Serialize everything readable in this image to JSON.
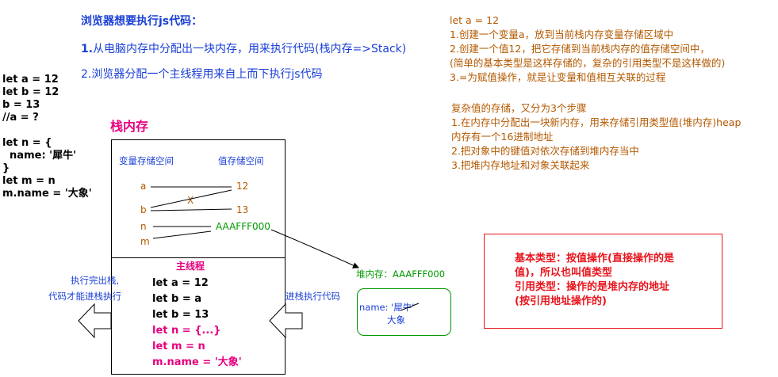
{
  "header": {
    "title": "浏览器想要执行js代码：",
    "step1_num": "1.",
    "step1_text": "从电脑内存中分配出一块内存，用来执行代码(栈内存=>Stack)",
    "step2": "2.浏览器分配一个主线程用来自上而下执行js代码"
  },
  "left_code": [
    "let a = 12",
    "let b = 12",
    "b = 13",
    "//a = ?",
    "",
    "let n = {",
    "  name: '犀牛'",
    "}",
    "let m = n",
    "m.name = '大象'"
  ],
  "stack": {
    "title": "栈内存",
    "var_area_label": "变量存储空间",
    "val_area_label": "值存储空间",
    "vars": [
      "a",
      "b",
      "n",
      "m"
    ],
    "vals": [
      "12",
      "13"
    ],
    "address": "AAAFFF000",
    "cross_mark": "X"
  },
  "main_thread": {
    "title": "主线程",
    "lines": [
      {
        "text": "let a = 12",
        "color": "#000000"
      },
      {
        "text": "let b = a",
        "color": "#000000"
      },
      {
        "text": "let b = 13",
        "color": "#000000"
      },
      {
        "text": "let n = {...}",
        "color": "#e6007e"
      },
      {
        "text": "let m = n",
        "color": "#e6007e"
      },
      {
        "text": "m.name = '大象'",
        "color": "#e6007e"
      }
    ]
  },
  "arrows": {
    "exit_label_1": "执行完出栈,",
    "exit_label_2": "代码才能进栈执行",
    "enter_label": "进栈执行代码"
  },
  "heap": {
    "label": "堆内存：AAAFFF000",
    "key": "name: '犀牛'",
    "new_value": "大象"
  },
  "notes_primitive": [
    "let a = 12",
    "1.创建一个变量a，放到当前栈内存变量存储区域中",
    "2.创建一个值12，把它存储到当前栈内存的值存储空间中，",
    "(简单的基本类型是这样存储的，复杂的引用类型不是这样做的)",
    "3.=为赋值操作，就是让变量和值相互关联的过程"
  ],
  "notes_complex": [
    "复杂值的存储，又分为3个步骤",
    "1.在内存中分配出一块新内存，用来存储引用类型值(堆内存)heap",
    "内存有一个16进制地址",
    "2.把对象中的键值对依次存储到堆内存当中",
    "3.把堆内存地址和对象关联起来"
  ],
  "summary": {
    "line1": "基本类型：按值操作(直接操作的是",
    "line2": "值)，所以也叫值类型",
    "line3": "引用类型：操作的是堆内存的地址",
    "line4": "(按引用地址操作的)"
  }
}
